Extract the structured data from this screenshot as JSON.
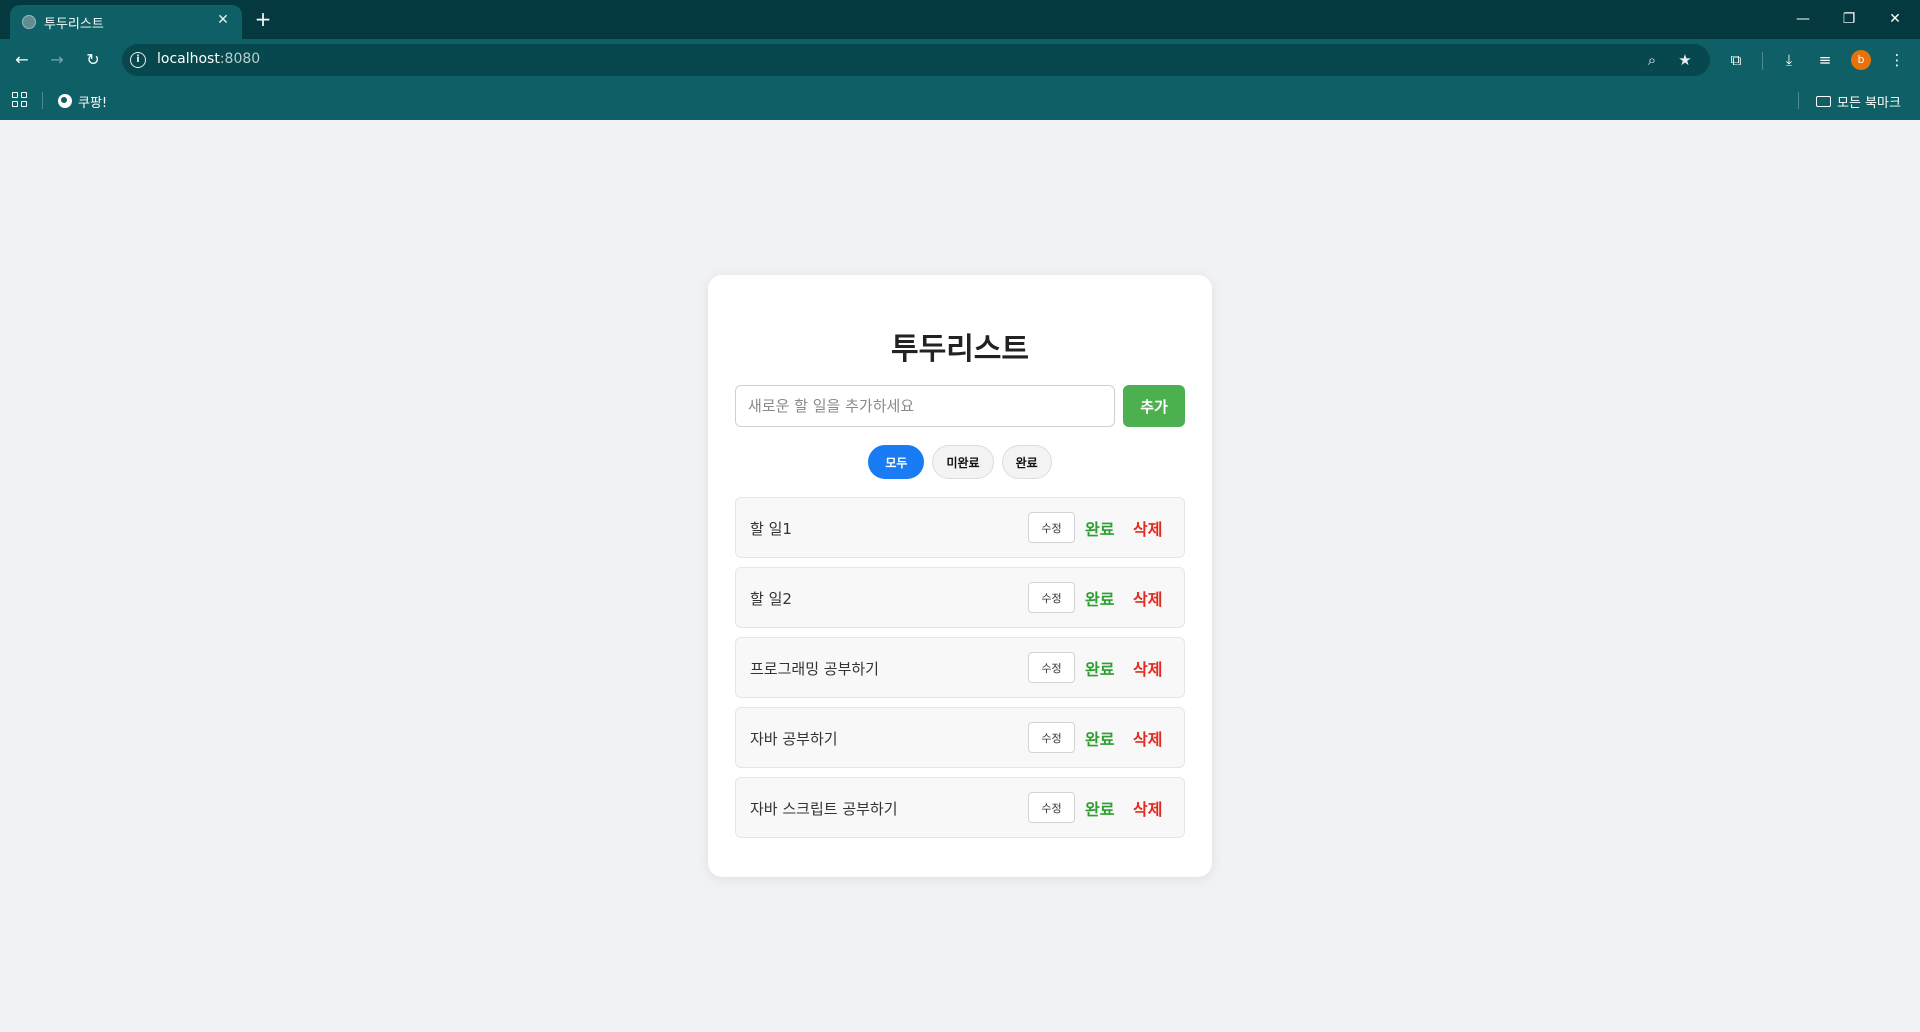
{
  "browser": {
    "tab": {
      "title": "투두리스트",
      "close_icon": "close-icon"
    },
    "new_tab_icon": "plus-icon",
    "window": {
      "minimize": "minimize-icon",
      "restore": "restore-icon",
      "close": "close-icon"
    },
    "address": {
      "host": "localhost",
      "port": ":8080"
    },
    "avatar_letter": "b",
    "bookmarks": [
      {
        "label": "쿠팡!"
      }
    ],
    "all_bookmarks_label": "모든 북마크"
  },
  "app": {
    "title": "투두리스트",
    "input_placeholder": "새로운 할 일을 추가하세요",
    "input_value": "",
    "add_label": "추가",
    "filters": [
      "모두",
      "미완료",
      "완료"
    ],
    "active_filter": "모두",
    "colors": {
      "primary": "#1a7cf5",
      "add": "#4caf50",
      "done": "#2e9e32",
      "delete": "#e02b20"
    },
    "todos": [
      {
        "text": "할 일1",
        "edit": "수정",
        "done": "완료",
        "delete": "삭제"
      },
      {
        "text": "할 일2",
        "edit": "수정",
        "done": "완료",
        "delete": "삭제"
      },
      {
        "text": "프로그래밍 공부하기",
        "edit": "수정",
        "done": "완료",
        "delete": "삭제"
      },
      {
        "text": "자바 공부하기",
        "edit": "수정",
        "done": "완료",
        "delete": "삭제"
      },
      {
        "text": "자바 스크립트 공부하기",
        "edit": "수정",
        "done": "완료",
        "delete": "삭제"
      }
    ]
  }
}
